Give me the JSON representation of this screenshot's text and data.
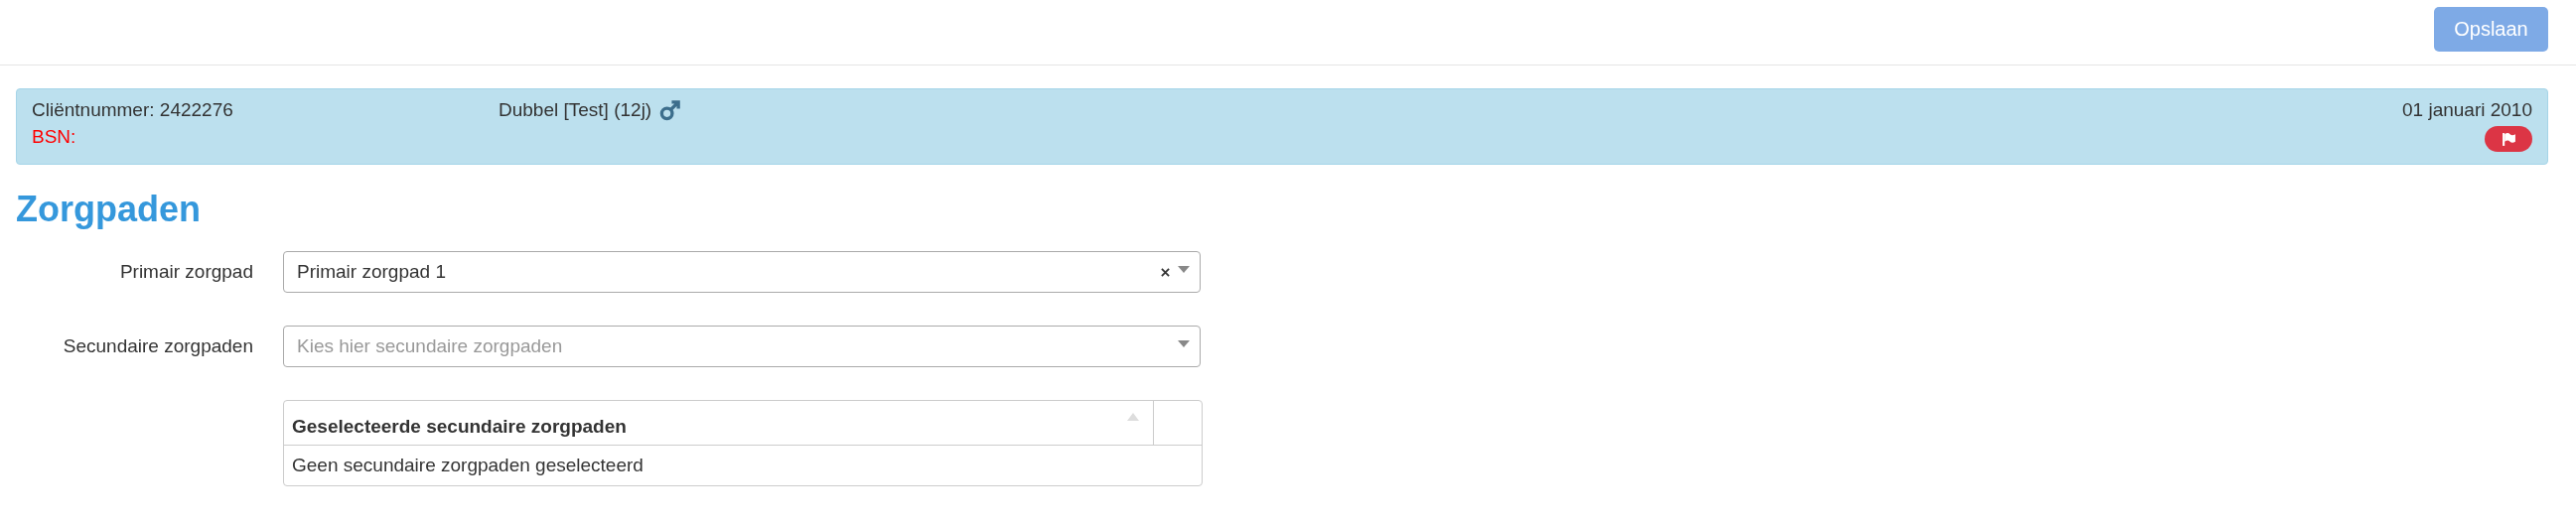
{
  "toolbar": {
    "save_button": {
      "label": "Opslaan",
      "disabled": true
    }
  },
  "client_banner": {
    "client_number": "Cliëntnummer: 2422276",
    "bsn": "BSN:",
    "name": "Dubbel [Test] (12j)",
    "date": "01 januari 2010"
  },
  "heading": "Zorgpaden",
  "fields": [
    {
      "label": "Primair zorgpad",
      "value": "Primair zorgpad 1",
      "clearable": true
    },
    {
      "label": "Secundaire zorgpaden",
      "placeholder": "Kies hier secundaire zorgpaden",
      "clearable": false
    }
  ],
  "table": {
    "columns": [
      "Geselecteerde secundaire zorgpaden"
    ],
    "empty_message": "Geen secundaire zorgpaden geselecteerd"
  }
}
